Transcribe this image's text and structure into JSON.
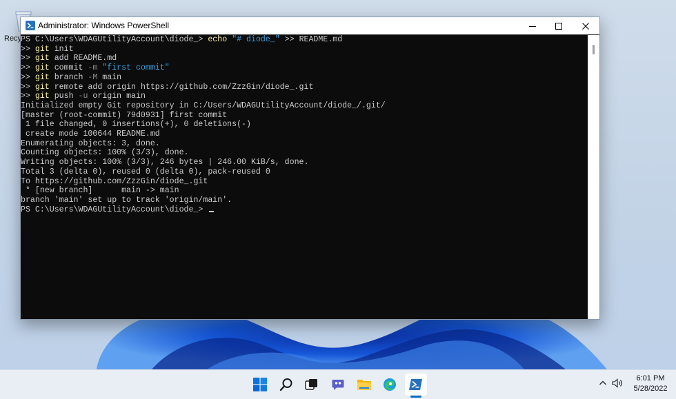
{
  "desktop": {
    "recycle_bin_label": "Recycle Bin"
  },
  "window": {
    "title": "Administrator: Windows PowerShell"
  },
  "console_lines": [
    [
      {
        "t": "PS C:\\Users\\WDAGUtilityAccount\\diode_> ",
        "c": ""
      },
      {
        "t": "echo",
        "c": "kw"
      },
      {
        "t": " ",
        "c": ""
      },
      {
        "t": "\"# diode_\"",
        "c": "str"
      },
      {
        "t": " >> README.md",
        "c": ""
      }
    ],
    [
      {
        "t": ">> ",
        "c": ""
      },
      {
        "t": "git",
        "c": "kw"
      },
      {
        "t": " init",
        "c": ""
      }
    ],
    [
      {
        "t": ">> ",
        "c": ""
      },
      {
        "t": "git",
        "c": "kw"
      },
      {
        "t": " add README.md",
        "c": ""
      }
    ],
    [
      {
        "t": ">> ",
        "c": ""
      },
      {
        "t": "git",
        "c": "kw"
      },
      {
        "t": " commit ",
        "c": ""
      },
      {
        "t": "-m",
        "c": "par"
      },
      {
        "t": " ",
        "c": ""
      },
      {
        "t": "\"first commit\"",
        "c": "str"
      }
    ],
    [
      {
        "t": ">> ",
        "c": ""
      },
      {
        "t": "git",
        "c": "kw"
      },
      {
        "t": " branch ",
        "c": ""
      },
      {
        "t": "-M",
        "c": "par"
      },
      {
        "t": " main",
        "c": ""
      }
    ],
    [
      {
        "t": ">> ",
        "c": ""
      },
      {
        "t": "git",
        "c": "kw"
      },
      {
        "t": " remote add origin https://github.com/ZzzGin/diode_.git",
        "c": ""
      }
    ],
    [
      {
        "t": ">> ",
        "c": ""
      },
      {
        "t": "git",
        "c": "kw"
      },
      {
        "t": " push ",
        "c": ""
      },
      {
        "t": "-u",
        "c": "par"
      },
      {
        "t": " origin main",
        "c": ""
      }
    ],
    [
      {
        "t": "Initialized empty Git repository in C:/Users/WDAGUtilityAccount/diode_/.git/",
        "c": ""
      }
    ],
    [
      {
        "t": "[master (root-commit) 79d0931] first commit",
        "c": ""
      }
    ],
    [
      {
        "t": " 1 file changed, 0 insertions(+), 0 deletions(-)",
        "c": ""
      }
    ],
    [
      {
        "t": " create mode 100644 README.md",
        "c": ""
      }
    ],
    [
      {
        "t": "Enumerating objects: 3, done.",
        "c": ""
      }
    ],
    [
      {
        "t": "Counting objects: 100% (3/3), done.",
        "c": ""
      }
    ],
    [
      {
        "t": "Writing objects: 100% (3/3), 246 bytes | 246.00 KiB/s, done.",
        "c": ""
      }
    ],
    [
      {
        "t": "Total 3 (delta 0), reused 0 (delta 0), pack-reused 0",
        "c": ""
      }
    ],
    [
      {
        "t": "To https://github.com/ZzzGin/diode_.git",
        "c": ""
      }
    ],
    [
      {
        "t": " * [new branch]      main -> main",
        "c": ""
      }
    ],
    [
      {
        "t": "branch 'main' set up to track 'origin/main'.",
        "c": ""
      }
    ],
    [
      {
        "t": "PS C:\\Users\\WDAGUtilityAccount\\diode_> ",
        "c": "",
        "cursor": true
      }
    ]
  ],
  "taskbar": {
    "apps": [
      {
        "name": "start-button",
        "icon": "windows-logo-icon"
      },
      {
        "name": "search-button",
        "icon": "search-icon"
      },
      {
        "name": "task-view-button",
        "icon": "task-view-icon"
      },
      {
        "name": "chat-button",
        "icon": "teams-chat-icon"
      },
      {
        "name": "file-explorer-button",
        "icon": "folder-icon"
      },
      {
        "name": "edge-button",
        "icon": "edge-icon"
      },
      {
        "name": "powershell-button",
        "icon": "powershell-icon",
        "active": true
      }
    ],
    "clock": {
      "time": "6:01 PM",
      "date": "5/28/2022"
    }
  },
  "colors": {
    "console_bg": "#0c0c0c",
    "console_text": "#cccccc",
    "command": "#f9f1a5",
    "string": "#3aa0e0",
    "parameter": "#8a8a8a",
    "accent": "#0067c0"
  }
}
